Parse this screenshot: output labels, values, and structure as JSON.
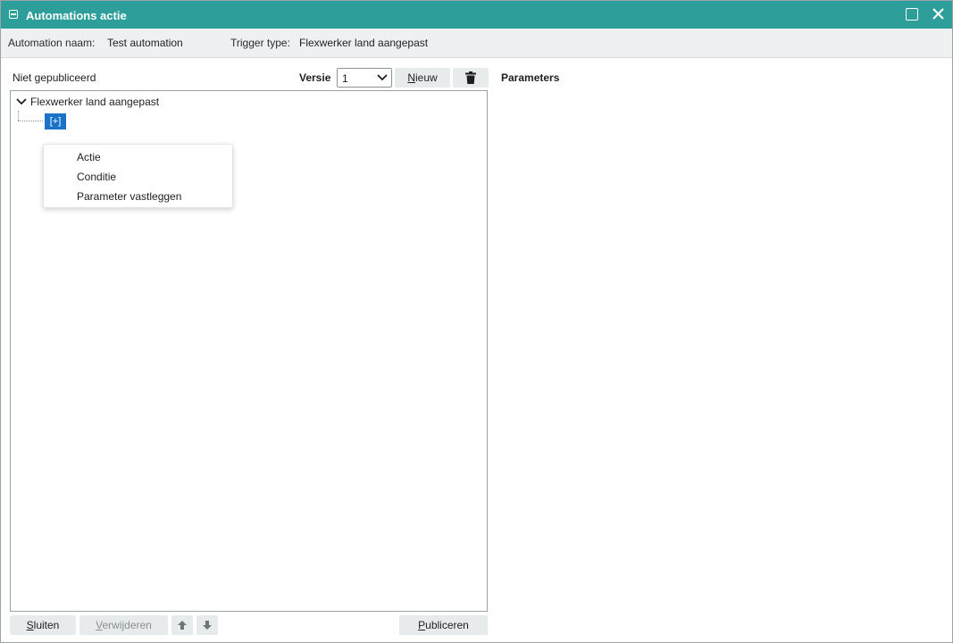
{
  "window": {
    "title": "Automations actie",
    "title_color": "#2e9e9b"
  },
  "info": {
    "automation_label": "Automation naam:",
    "automation_value": "Test automation",
    "trigger_label": "Trigger type:",
    "trigger_value": "Flexwerker land aangepast"
  },
  "editor": {
    "status": "Niet gepubliceerd",
    "versie_label": "Versie",
    "versie_value": "1",
    "nieuw_first": "N",
    "nieuw_rest": "ieuw"
  },
  "tree": {
    "root_label": "Flexwerker land aangepast",
    "add_node_label": "[+]"
  },
  "context_menu": {
    "items": [
      "Actie",
      "Conditie",
      "Parameter vastleggen"
    ]
  },
  "parameters": {
    "title": "Parameters"
  },
  "footer": {
    "sluiten_first": "S",
    "sluiten_rest": "luiten",
    "verwijderen_first": "V",
    "verwijderen_rest": "erwijderen",
    "publiceren_first": "P",
    "publiceren_rest": "ubliceren"
  },
  "icons": {
    "app": "window-icon",
    "maximize": "maximize-icon",
    "close": "close-icon",
    "dropdown": "chevron-down-icon",
    "delete": "trash-icon",
    "expand": "chevron-down-icon",
    "up": "arrow-up-icon",
    "down": "arrow-down-icon"
  },
  "colors": {
    "accent": "#2e9e9b",
    "selection": "#1a73c9"
  }
}
